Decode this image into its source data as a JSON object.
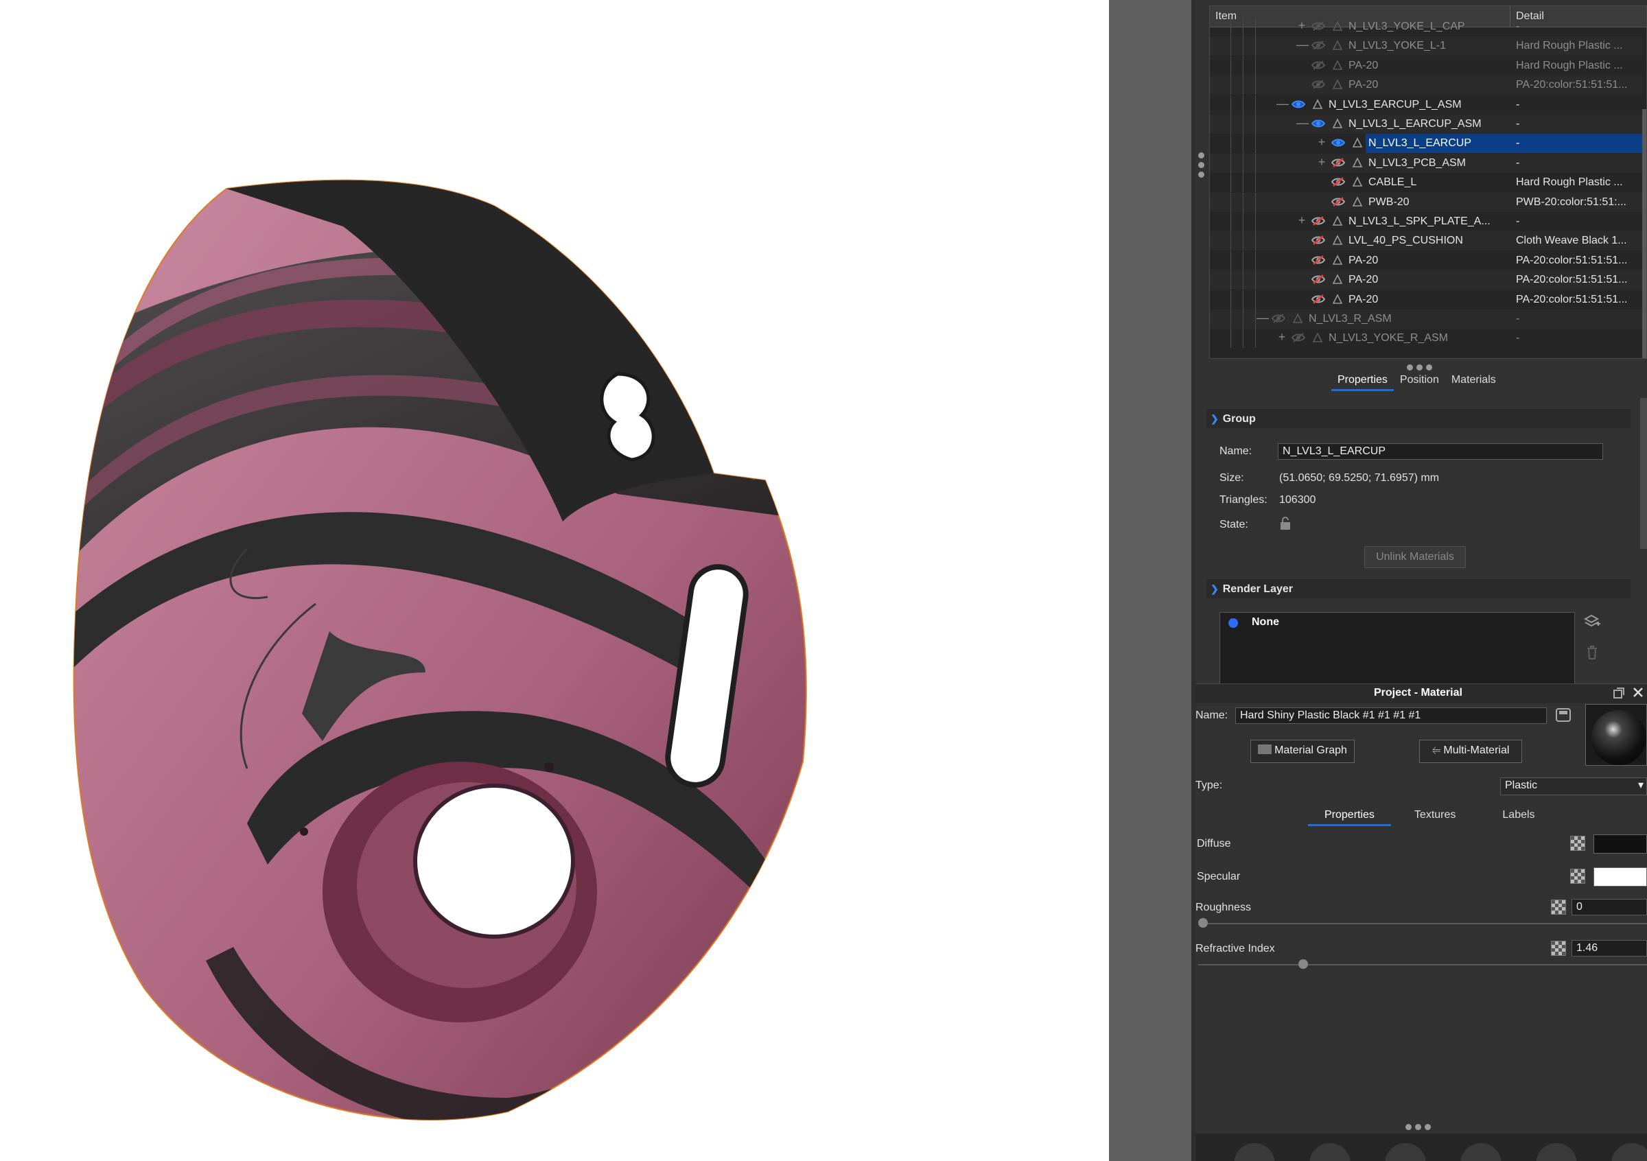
{
  "tree": {
    "col_item": "Item",
    "col_detail": "Detail",
    "rows": [
      {
        "name": "N_LVL3_YOKE_L_CAP",
        "detail": "-"
      },
      {
        "name": "N_LVL3_YOKE_L-1",
        "detail": "Hard Rough Plastic ..."
      },
      {
        "name": "PA-20",
        "detail": "Hard Rough Plastic ..."
      },
      {
        "name": "PA-20",
        "detail": "PA-20:color:51:51:51..."
      },
      {
        "name": "N_LVL3_EARCUP_L_ASM",
        "detail": "-"
      },
      {
        "name": "N_LVL3_L_EARCUP_ASM",
        "detail": "-"
      },
      {
        "name": "N_LVL3_L_EARCUP",
        "detail": "-"
      },
      {
        "name": "N_LVL3_PCB_ASM",
        "detail": "-"
      },
      {
        "name": "CABLE_L",
        "detail": "Hard Rough Plastic ..."
      },
      {
        "name": "PWB-20",
        "detail": "PWB-20:color:51:51:..."
      },
      {
        "name": "N_LVL3_L_SPK_PLATE_A...",
        "detail": "-"
      },
      {
        "name": "LVL_40_PS_CUSHION",
        "detail": "Cloth Weave Black 1..."
      },
      {
        "name": "PA-20",
        "detail": "PA-20:color:51:51:51..."
      },
      {
        "name": "PA-20",
        "detail": "PA-20:color:51:51:51..."
      },
      {
        "name": "PA-20",
        "detail": "PA-20:color:51:51:51..."
      },
      {
        "name": "N_LVL3_R_ASM",
        "detail": "-"
      },
      {
        "name": "N_LVL3_YOKE_R_ASM",
        "detail": "-"
      }
    ]
  },
  "inspector_tabs": [
    "Properties",
    "Position",
    "Materials"
  ],
  "group": {
    "section_title": "Group",
    "name_label": "Name:",
    "name_value": "N_LVL3_L_EARCUP",
    "size_label": "Size:",
    "size_value": "(51.0650; 69.5250; 71.6957) mm",
    "triangles_label": "Triangles:",
    "triangles_value": "106300",
    "state_label": "State:",
    "unlink_label": "Unlink Materials"
  },
  "render_layer": {
    "section_title": "Render Layer",
    "items": [
      "None"
    ]
  },
  "material": {
    "panel_title": "Project - Material",
    "name_label": "Name:",
    "name_value": "Hard Shiny Plastic Black #1 #1 #1 #1",
    "graph_label": "Material Graph",
    "multi_label": "Multi-Material",
    "type_label": "Type:",
    "type_value": "Plastic",
    "tabs": [
      "Properties",
      "Textures",
      "Labels"
    ],
    "diffuse_label": "Diffuse",
    "diffuse_color": "#111111",
    "specular_label": "Specular",
    "specular_color": "#ffffff",
    "roughness_label": "Roughness",
    "roughness_value": "0",
    "refractive_label": "Refractive Index",
    "refractive_value": "1.46"
  },
  "colors": {
    "accent": "#1f6fd9",
    "selection": "#0a3e86",
    "panel_bg": "#323232",
    "model_pink": "#b06a84",
    "model_black": "#2b2b2b"
  }
}
